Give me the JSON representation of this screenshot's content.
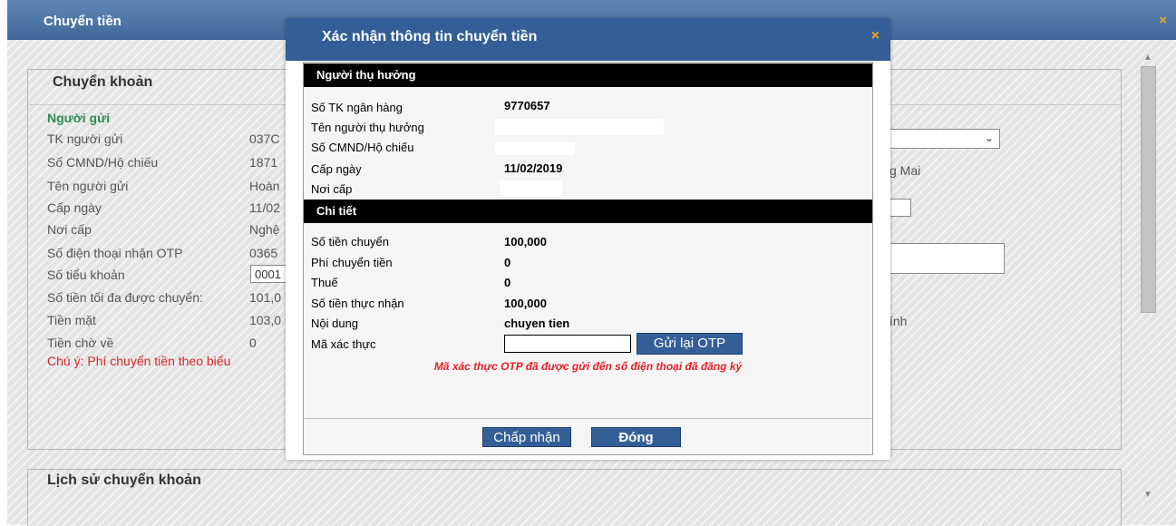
{
  "window": {
    "title": "Chuyển tiền",
    "close_icon": "×"
  },
  "panel_transfer": {
    "title": "Chuyển khoản",
    "sender_heading": "Người gửi",
    "rows": [
      {
        "label": "TK người gửi",
        "value": "037C"
      },
      {
        "label": "Số CMND/Hộ chiếu",
        "value": "1871"
      },
      {
        "label": "Tên người gửi",
        "value": "Hoàn"
      },
      {
        "label": "Cấp ngày",
        "value": "11/02"
      },
      {
        "label": "Nơi cấp",
        "value": "Nghệ"
      },
      {
        "label": "Số điện thoại nhận OTP",
        "value": "0365"
      },
      {
        "label": "Số tiểu khoản",
        "value": "0001"
      },
      {
        "label": "Số tiền tối đa được chuyển:",
        "value": "101,0"
      },
      {
        "label": "Tiền mặt",
        "value": "103,0"
      },
      {
        "label": "Tiền chờ về",
        "value": "0"
      }
    ],
    "note": "Chú ý: Phí chuyển tiền theo biểu",
    "right_text_1": "g Mai",
    "right_text_2": "ính"
  },
  "panel_history": {
    "title": "Lịch sử chuyển khoản"
  },
  "modal": {
    "title": "Xác nhận thông tin chuyển tiền",
    "close_icon": "×",
    "beneficiary_section": "Người thụ hưởng",
    "beneficiary_rows": [
      {
        "label": "Số TK ngân hàng",
        "value": "9770657"
      },
      {
        "label": "Tên người thụ hưởng",
        "value": ""
      },
      {
        "label": "Số CMND/Hộ chiếu",
        "value": ""
      },
      {
        "label": "Cấp ngày",
        "value": "11/02/2019"
      },
      {
        "label": "Nơi cấp",
        "value": ""
      }
    ],
    "details_section": "Chi tiết",
    "detail_rows": [
      {
        "label": "Số tiền chuyển",
        "value": "100,000"
      },
      {
        "label": "Phí chuyển tiền",
        "value": "0"
      },
      {
        "label": "Thuế",
        "value": "0"
      },
      {
        "label": "Số tiền thực nhận",
        "value": "100,000"
      },
      {
        "label": "Nội dung",
        "value": "chuyen tien"
      }
    ],
    "otp_label": "Mã xác thực",
    "otp_value": "",
    "otp_resend_label": "Gửi lại OTP",
    "otp_message": "Mã xác thực OTP đã được gửi đến số điện thoại đã đăng ký",
    "accept_label": "Chấp nhận",
    "close_label": "Đóng"
  },
  "colors": {
    "title_bar": "#4a75a6",
    "modal_header": "#335f96",
    "accent": "#f3a424",
    "sender_green": "#2e8b57",
    "warning_red": "#d9272e"
  }
}
